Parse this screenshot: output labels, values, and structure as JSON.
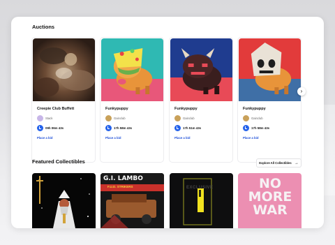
{
  "auctions": {
    "title": "Auctions",
    "items": [
      {
        "title": "Creepie Club Buffett",
        "creator": "Stack",
        "time": "09h 06m 43s",
        "bid_label": "Place a bid"
      },
      {
        "title": "Funkypuppy",
        "creator": "Gainclub",
        "time": "17h 58m 43s",
        "bid_label": "Place a bid"
      },
      {
        "title": "Funkypuppy",
        "creator": "Gainclub",
        "time": "17h 51m 43s",
        "bid_label": "Place a bid"
      },
      {
        "title": "Funkypuppy",
        "creator": "Gainclub",
        "time": "17h 58m 43s",
        "bid_label": "Place a bid"
      }
    ],
    "next_icon": "chevron-right-icon"
  },
  "featured": {
    "title": "Featured Collectibles",
    "explore_label": "Explore All Collectibles",
    "explore_icon": "arrow-right-icon",
    "tiles": [
      {
        "art_text": ""
      },
      {
        "art_text": "G.I. LAMBO",
        "art_subtext": "F.U.D. STRIKERS"
      },
      {
        "art_text": "EXCLUSIVE"
      },
      {
        "art_text": "NO MORE WAR"
      }
    ]
  },
  "colors": {
    "accent": "#2563eb",
    "link": "#1d4ed8"
  }
}
